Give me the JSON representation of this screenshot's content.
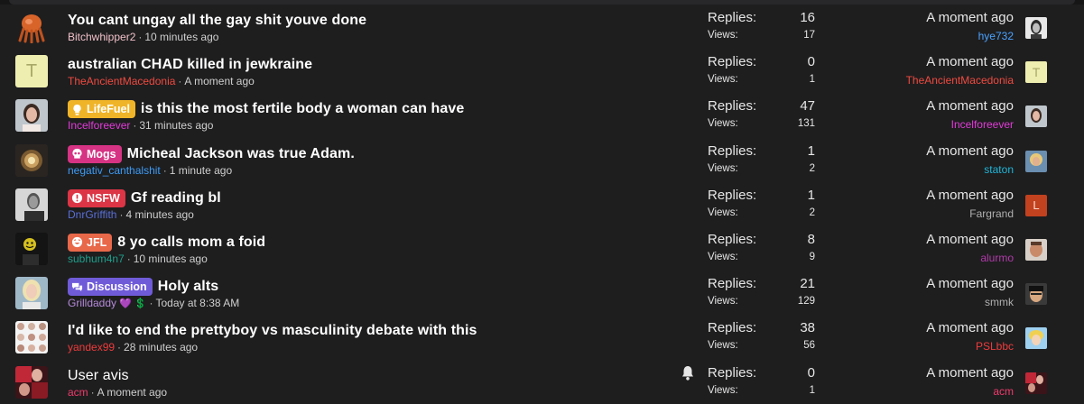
{
  "threads": [
    {
      "title": "You cant ungay all the gay shit youve done",
      "title_bold": true,
      "prefix": null,
      "author": "Bitchwhipper2",
      "author_color": "#f0c0c8",
      "time": "10 minutes ago",
      "replies_label": "Replies:",
      "replies": "16",
      "views_label": "Views:",
      "views": "17",
      "last_time": "A moment ago",
      "last_user": "hye732",
      "last_user_color": "#4aa3ff",
      "avatar": "orange-creature",
      "last_avatar": "bw-portrait"
    },
    {
      "title": "australian CHAD killed in jewkraine",
      "title_bold": true,
      "prefix": null,
      "author": "TheAncientMacedonia",
      "author_color": "#ef4a3f",
      "time": "A moment ago",
      "replies_label": "Replies:",
      "replies": "0",
      "views_label": "Views:",
      "views": "1",
      "last_time": "A moment ago",
      "last_user": "TheAncientMacedonia",
      "last_user_color": "#ef4a3f",
      "avatar_letter": "T",
      "last_avatar_letter": "T"
    },
    {
      "title": "is this the most fertile body a woman can have",
      "title_bold": true,
      "prefix": {
        "label": "LifeFuel",
        "color": "#f0b429",
        "icon": "lightbulb-icon"
      },
      "author": "Incelforeever",
      "author_color": "#e23bd8",
      "time": "31 minutes ago",
      "replies_label": "Replies:",
      "replies": "47",
      "views_label": "Views:",
      "views": "131",
      "last_time": "A moment ago",
      "last_user": "Incelforeever",
      "last_user_color": "#e23bd8",
      "avatar": "woman-portrait",
      "last_avatar": "woman-portrait"
    },
    {
      "title": "Micheal Jackson was true Adam.",
      "title_bold": true,
      "prefix": {
        "label": "Mogs",
        "color": "#d63384",
        "icon": "skull-icon"
      },
      "author": "negativ_canthalshit",
      "author_color": "#3d9bf5",
      "time": "1 minute ago",
      "replies_label": "Replies:",
      "replies": "1",
      "views_label": "Views:",
      "views": "2",
      "last_time": "A moment ago",
      "last_user": "staton",
      "last_user_color": "#21b5d6",
      "avatar": "glow-orb",
      "last_avatar": "blond-portrait"
    },
    {
      "title": "Gf reading bl",
      "title_bold": true,
      "prefix": {
        "label": "NSFW",
        "color": "#dc3545",
        "icon": "alert-icon"
      },
      "author": "DnrGriffith",
      "author_color": "#5a6fd6",
      "time": "4 minutes ago",
      "replies_label": "Replies:",
      "replies": "1",
      "views_label": "Views:",
      "views": "2",
      "last_time": "A moment ago",
      "last_user": "Fargrand",
      "last_user_color": "#b0b0b0",
      "avatar": "bw-man",
      "last_avatar_letter": "L"
    },
    {
      "title": "8 yo calls mom a foid",
      "title_bold": true,
      "prefix": {
        "label": "JFL",
        "color": "#e8684a",
        "icon": "laugh-icon"
      },
      "author": "subhum4n7",
      "author_color": "#1f9e8a",
      "time": "10 minutes ago",
      "replies_label": "Replies:",
      "replies": "8",
      "views_label": "Views:",
      "views": "9",
      "last_time": "A moment ago",
      "last_user": "alurmo",
      "last_user_color": "#b03aa8",
      "avatar": "yellow-face",
      "last_avatar": "man-face"
    },
    {
      "title": "Holy alts",
      "title_bold": true,
      "prefix": {
        "label": "Discussion",
        "color": "#6f5bd8",
        "icon": "chat-icon"
      },
      "author": "Grilldaddy",
      "author_color": "#b58ad8",
      "author_suffix": "💜 💲",
      "time": "Today at 8:38 AM",
      "replies_label": "Replies:",
      "replies": "21",
      "views_label": "Views:",
      "views": "129",
      "last_time": "A moment ago",
      "last_user": "smmk",
      "last_user_color": "#b0b0b0",
      "avatar": "blonde-girl",
      "last_avatar": "asian-man"
    },
    {
      "title": "I'd like to end the prettyboy vs masculinity debate with this",
      "title_bold": true,
      "prefix": null,
      "author": "yandex99",
      "author_color": "#ef3b3b",
      "time": "28 minutes ago",
      "replies_label": "Replies:",
      "replies": "38",
      "views_label": "Views:",
      "views": "56",
      "last_time": "A moment ago",
      "last_user": "PSLbbc",
      "last_user_color": "#ef3b3b",
      "avatar": "face-grid",
      "last_avatar": "cartoon-blond"
    },
    {
      "title": "User avis",
      "title_bold": false,
      "prefix": null,
      "author": "acm",
      "author_color": "#ef3b6b",
      "time": "A moment ago",
      "replies_label": "Replies:",
      "replies": "0",
      "views_label": "Views:",
      "views": "1",
      "last_time": "A moment ago",
      "last_user": "acm",
      "last_user_color": "#ef3b6b",
      "avatar": "red-collage",
      "last_avatar": "red-collage",
      "watch_icon": "bell-icon"
    }
  ]
}
